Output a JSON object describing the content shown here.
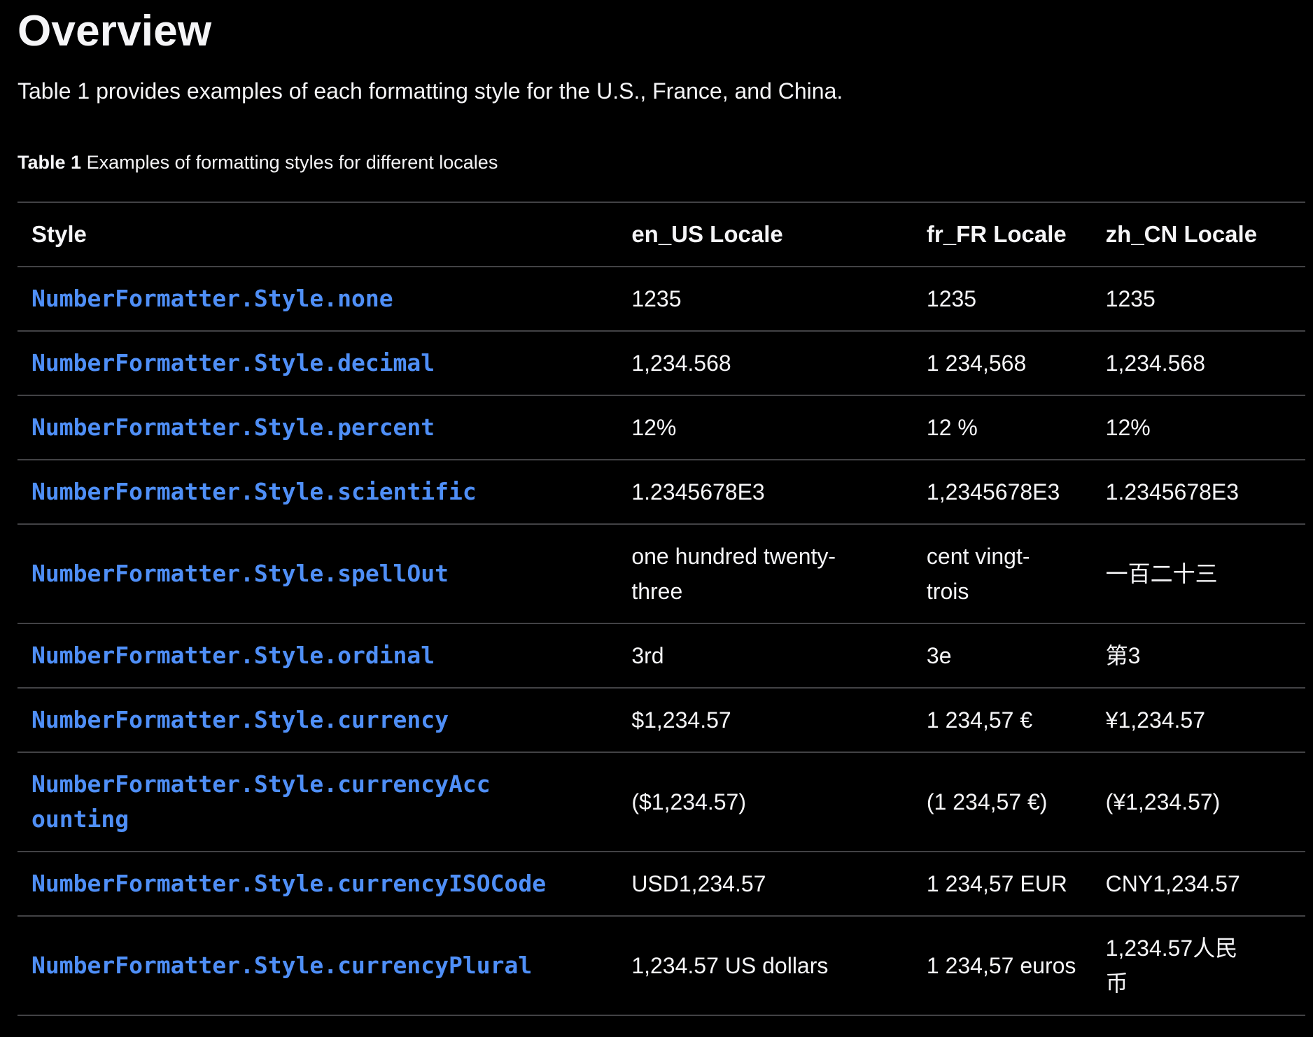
{
  "heading": "Overview",
  "intro": "Table 1 provides examples of each formatting style for the U.S., France, and China.",
  "caption": {
    "label": "Table 1",
    "text": "Examples of formatting styles for different locales"
  },
  "table": {
    "headers": [
      "Style",
      "en_US Locale",
      "fr_FR Locale",
      "zh_CN Locale"
    ],
    "rows": [
      {
        "style": "NumberFormatter.Style.none",
        "en_US": "1235",
        "fr_FR": "1235",
        "zh_CN": "1235"
      },
      {
        "style": "NumberFormatter.Style.decimal",
        "en_US": "1,234.568",
        "fr_FR": "1 234,568",
        "zh_CN": "1,234.568"
      },
      {
        "style": "NumberFormatter.Style.percent",
        "en_US": "12%",
        "fr_FR": "12 %",
        "zh_CN": "12%"
      },
      {
        "style": "NumberFormatter.Style.scientific",
        "en_US": "1.2345678E3",
        "fr_FR": "1,2345678E3",
        "zh_CN": "1.2345678E3"
      },
      {
        "style": "NumberFormatter.Style.spellOut",
        "en_US": "one hundred twenty-three",
        "fr_FR": "cent vingt-trois",
        "zh_CN": "一百二十三"
      },
      {
        "style": "NumberFormatter.Style.ordinal",
        "en_US": "3rd",
        "fr_FR": "3e",
        "zh_CN": "第3"
      },
      {
        "style": "NumberFormatter.Style.currency",
        "en_US": "$1,234.57",
        "fr_FR": "1 234,57 €",
        "zh_CN": "¥1,234.57"
      },
      {
        "style": "NumberFormatter.Style.currencyAccounting",
        "en_US": "($1,234.57)",
        "fr_FR": "(1 234,57 €)",
        "zh_CN": "(¥1,234.57)"
      },
      {
        "style": "NumberFormatter.Style.currencyISOCode",
        "en_US": "USD1,234.57",
        "fr_FR": "1 234,57 EUR",
        "zh_CN": "CNY1,234.57"
      },
      {
        "style": "NumberFormatter.Style.currencyPlural",
        "en_US": "1,234.57 US dollars",
        "fr_FR": "1 234,57 euros",
        "zh_CN": "1,234.57人民币"
      }
    ]
  },
  "colors": {
    "background": "#000000",
    "text": "#f5f5f7",
    "link": "#4f8ff7",
    "divider": "#424245"
  }
}
